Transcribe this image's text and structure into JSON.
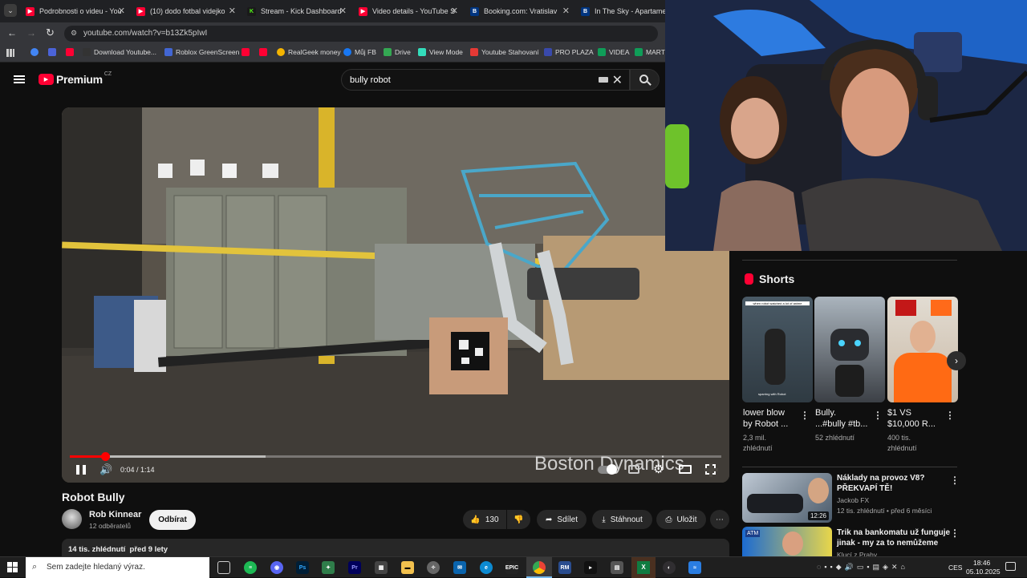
{
  "tabs": [
    {
      "title": "Podrobnosti o videu - You",
      "color": "#ff0033",
      "glyph": "▶"
    },
    {
      "title": "(10) dodo fotbal videjko",
      "color": "#ff0033",
      "glyph": "▶"
    },
    {
      "title": "Stream - Kick Dashboard",
      "color": "#53fc18",
      "glyph": "K"
    },
    {
      "title": "Video details - YouTube S",
      "color": "#ff0033",
      "glyph": "▶"
    },
    {
      "title": "Booking.com: Vratislav",
      "color": "#003580",
      "glyph": "B"
    },
    {
      "title": "In The Sky - Apartamenty",
      "color": "#003580",
      "glyph": "B"
    }
  ],
  "address": {
    "url": "youtube.com/watch?v=b13Zk5pIwI"
  },
  "bookmarks": [
    {
      "label": "",
      "color": "#4285f4"
    },
    {
      "label": "",
      "color": "#ff0033"
    },
    {
      "label": "Download Youtube...",
      "color": "#333"
    },
    {
      "label": "Roblox GreenScreen",
      "color": "#4266d3"
    },
    {
      "label": "",
      "color": "#ff0033"
    },
    {
      "label": "",
      "color": "#ff0033"
    },
    {
      "label": "RealGeek money",
      "color": "#f4b400"
    },
    {
      "label": "Můj FB",
      "color": "#1877f2"
    },
    {
      "label": "Drive",
      "color": "#34a853"
    },
    {
      "label": "View Mode",
      "color": "#3db"
    },
    {
      "label": "Youtube Stahovaní",
      "color": "#e53935"
    },
    {
      "label": "PRO PLAZA",
      "color": "#3949ab"
    },
    {
      "label": "VIDEA",
      "color": "#0f9d58"
    },
    {
      "label": "MARTY",
      "color": "#0f9d58"
    }
  ],
  "header": {
    "logo": "Premium",
    "region": "CZ",
    "search_value": "bully robot"
  },
  "player": {
    "time": "0:04 / 1:14",
    "progress": 0.054,
    "buffered": 0.3,
    "watermark": "Boston Dynamics"
  },
  "video": {
    "title": "Robot Bully",
    "channel": "Rob Kinnear",
    "subs": "12 odběratelů",
    "subscribe": "Odbírat",
    "likes": "130",
    "share": "Sdílet",
    "download": "Stáhnout",
    "save": "Uložit",
    "desc_meta": "14 tis. zhlédnutí  před 9 lety"
  },
  "shorts": {
    "heading": "Shorts",
    "items": [
      {
        "title_lines": [
          "lower blow",
          "by Robot ..."
        ],
        "meta_lines": [
          "2,3 mil.",
          "zhlédnutí"
        ],
        "thumb_text": "when robot watched a lot of anime",
        "thumb_text2": "sparring with Robot"
      },
      {
        "title_lines": [
          "Bully.",
          "...#bully #tb..."
        ],
        "meta_lines": [
          "52 zhlédnutí"
        ]
      },
      {
        "title_lines": [
          "$1 VS",
          "$10,000  R..."
        ],
        "meta_lines": [
          "400 tis.",
          "zhlédnutí"
        ]
      }
    ]
  },
  "recommended": [
    {
      "title_lines": [
        "Náklady na provoz V8?",
        "PŘEKVAPÍ TĚ!"
      ],
      "channel": "Jackob FX",
      "meta": "12 tis. zhlédnutí • před 6 měsíci",
      "duration": "12:26"
    },
    {
      "title_lines": [
        "Trik na bankomatu už funguje",
        "jinak - my za to nemůžeme"
      ],
      "channel": "Klucí z Prahy",
      "meta": "",
      "duration": ""
    }
  ],
  "taskbar": {
    "search_placeholder": "Sem zadejte hledaný výraz.",
    "lang": "CES",
    "time": "18:46",
    "date": "05.10.2025",
    "icons": [
      "task-view",
      "spotify",
      "discord",
      "photoshop",
      "robinhood",
      "premiere",
      "store",
      "explorer",
      "ai-app",
      "outlook",
      "edge",
      "epic",
      "chrome",
      "rm",
      "terminal",
      "calculator",
      "excel",
      "obs",
      "app"
    ]
  }
}
